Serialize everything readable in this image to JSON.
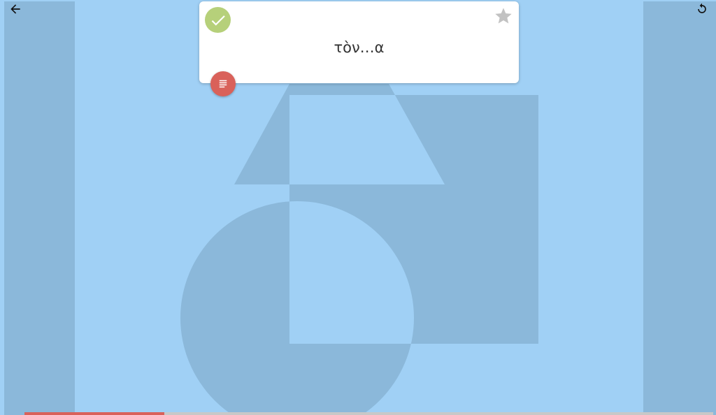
{
  "card": {
    "word": "τὸν…α",
    "status_icon": "check-circle-icon",
    "favorite_icon": "star-icon"
  },
  "toolbar": {
    "back_icon": "arrow-left-icon",
    "reload_icon": "refresh-icon"
  },
  "notes_button": {
    "icon": "notes-icon"
  },
  "progress": {
    "fraction": 0.203
  },
  "colors": {
    "background": "#a0d0f5",
    "shape": "#8bb8da",
    "check": "#b6d07a",
    "notes": "#d9615a",
    "star": "#c2c2c2",
    "progress_fill": "#d9615a",
    "progress_track": "#c8c8c8"
  }
}
